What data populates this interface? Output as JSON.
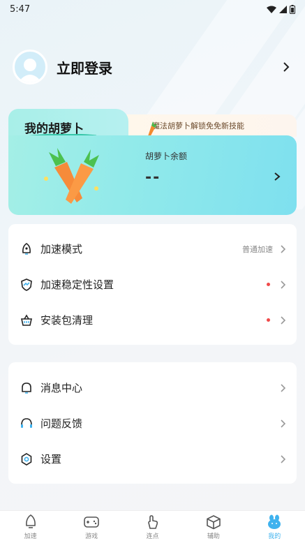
{
  "status_bar": {
    "time": "5:47"
  },
  "header": {
    "login_label": "立即登录"
  },
  "carrot_card": {
    "title": "我的胡萝卜",
    "promo_text": "魔法胡萝卜解锁免免新技能",
    "balance_label": "胡萝卜余额",
    "balance_value": "--"
  },
  "settings_group": {
    "items": [
      {
        "label": "加速模式",
        "value": "普通加速",
        "icon": "bell-rocket-icon"
      },
      {
        "label": "加速稳定性设置",
        "icon": "shield-chart-icon",
        "badge_dot": true
      },
      {
        "label": "安装包清理",
        "icon": "basket-icon",
        "badge_dot": true
      }
    ]
  },
  "misc_group": {
    "items": [
      {
        "label": "消息中心",
        "icon": "bell-icon"
      },
      {
        "label": "问题反馈",
        "icon": "headset-icon"
      },
      {
        "label": "设置",
        "icon": "gear-icon"
      }
    ]
  },
  "bottom_nav": {
    "items": [
      {
        "label": "加速",
        "icon": "rocket-icon",
        "active": false
      },
      {
        "label": "游戏",
        "icon": "gamepad-icon",
        "active": false
      },
      {
        "label": "连点",
        "icon": "tap-icon",
        "active": false
      },
      {
        "label": "辅助",
        "icon": "cube-icon",
        "active": false
      },
      {
        "label": "我的",
        "icon": "bunny-icon",
        "active": true
      }
    ]
  },
  "colors": {
    "accent": "#3fb2ee",
    "badge_dot": "#f04a4a",
    "card_teal": "#92eaea"
  }
}
